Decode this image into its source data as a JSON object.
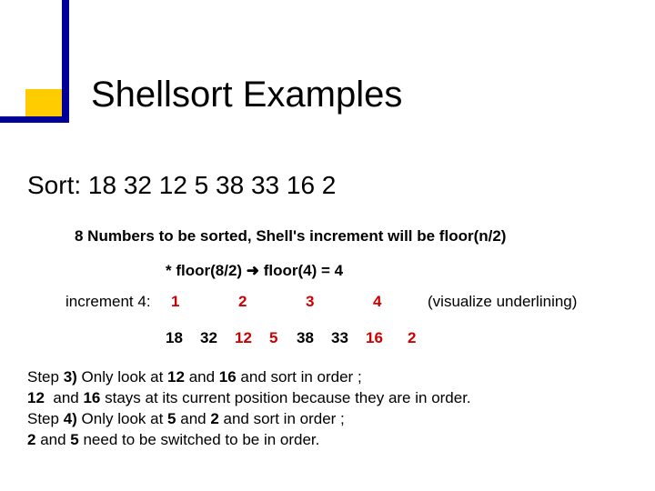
{
  "title": "Shellsort Examples",
  "sort_line": "Sort: 18   32   12   5   38   33   16   2",
  "subnote": "8 Numbers to be sorted, Shell's increment will be floor(n/2)",
  "floor_line": "* floor(8/2) ➜ floor(4) = 4",
  "incr": {
    "label": "increment 4:",
    "c1": "1",
    "c2": "2",
    "c3": "3",
    "c4": "4",
    "viz": "(visualize underlining)"
  },
  "nums": {
    "n18": "18",
    "n32": "32",
    "n12": "12",
    "n5": "5",
    "n38": "38",
    "n33": "33",
    "n16": "16",
    "n2": "2"
  },
  "steps": {
    "s3a_pre": "Step ",
    "s3a_b1": "3)",
    "s3a_mid1": " Only look at ",
    "s3a_b2": "12",
    "s3a_mid2": " and ",
    "s3a_b3": "16",
    "s3a_mid3": " and sort in order ;",
    "s3b_b1": "12",
    "s3b_mid1": "  and ",
    "s3b_b2": "16",
    "s3b_mid2": " stays at its current position because they are in order.",
    "s4a_pre": "Step ",
    "s4a_b1": "4)",
    "s4a_mid1": " Only look at ",
    "s4a_b2": "5",
    "s4a_mid2": " and ",
    "s4a_b3": "2",
    "s4a_mid3": " and sort in order ;",
    "s4b_b1": "2",
    "s4b_mid1": " and ",
    "s4b_b2": "5",
    "s4b_mid2": " need to be switched to be in order."
  }
}
